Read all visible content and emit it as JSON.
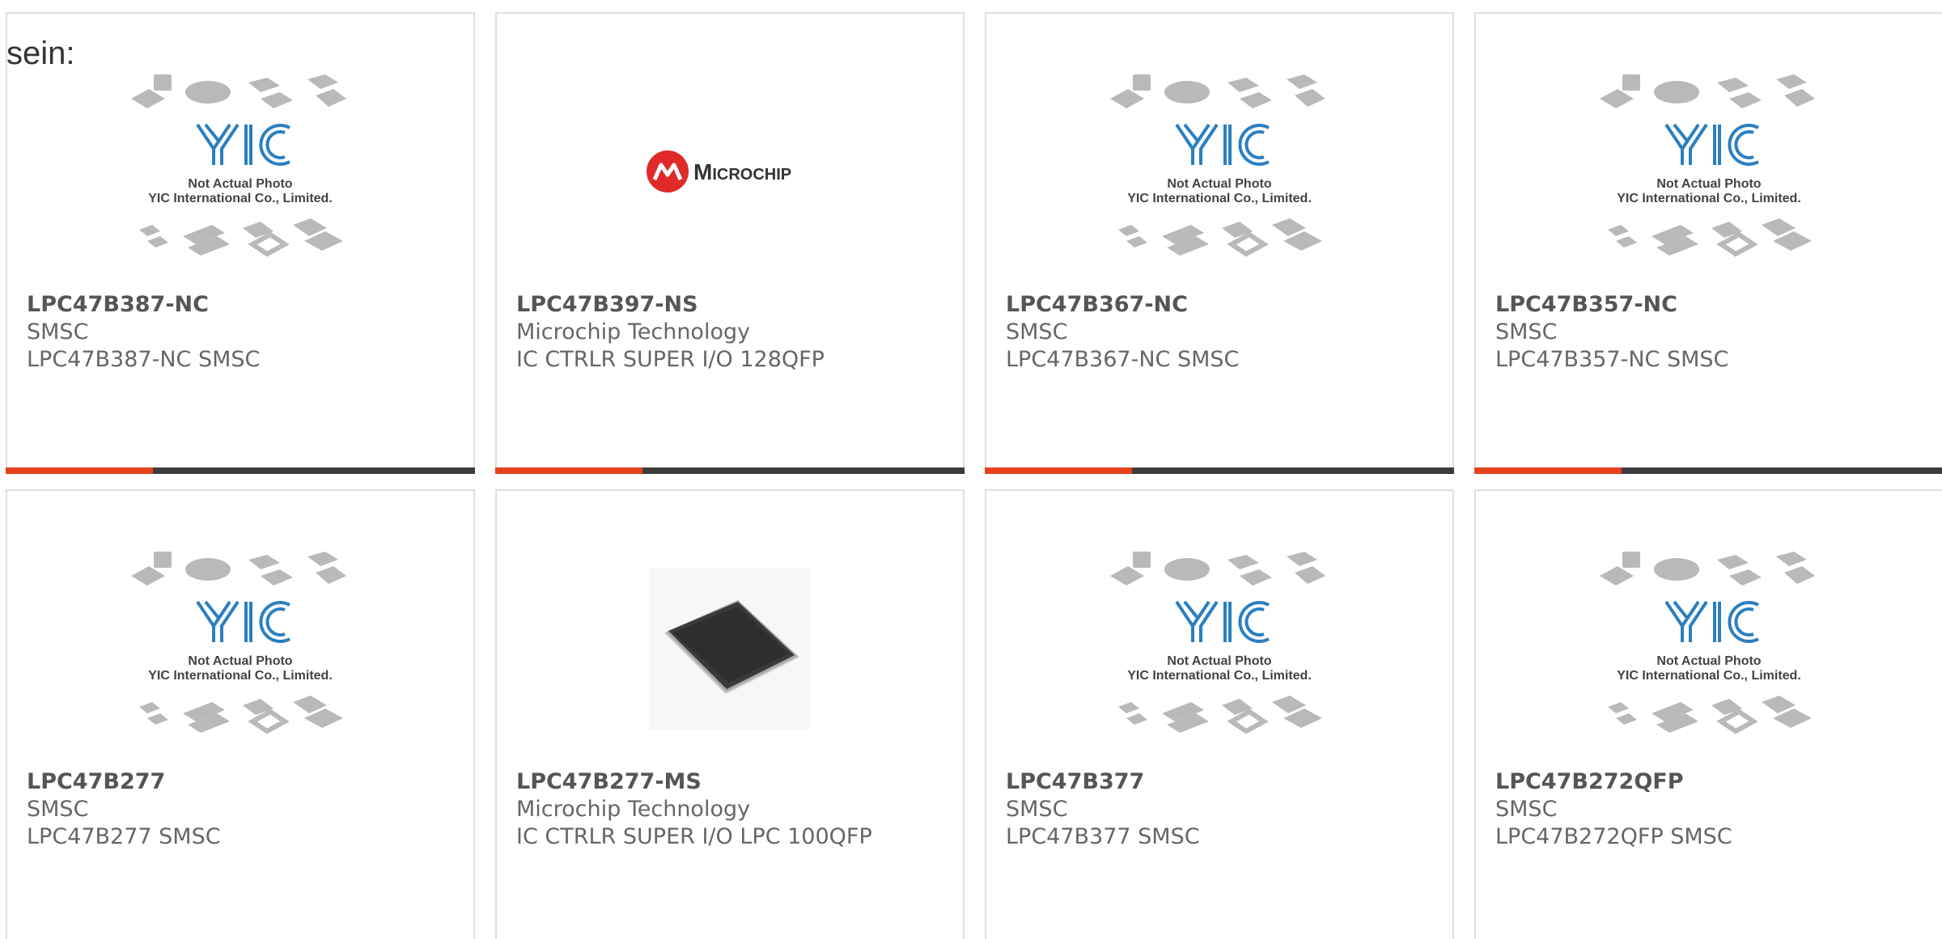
{
  "heading": "sein:",
  "placeholder": {
    "line1": "Not Actual Photo",
    "line2": "YIC International Co., Limited."
  },
  "brand_logo_text": "Microchip",
  "colors": {
    "accent": "#e6401c",
    "bar": "#3d3d3d",
    "logo_red": "#e02a2a",
    "yic_blue": "#2a7fc1"
  },
  "cards": [
    {
      "pn": "LPC47B387-NC",
      "mfr": "SMSC",
      "desc": "LPC47B387-NC SMSC",
      "image": "yic-placeholder"
    },
    {
      "pn": "LPC47B397-NS",
      "mfr": "Microchip Technology",
      "desc": "IC CTRLR SUPER I/O 128QFP",
      "image": "microchip-logo"
    },
    {
      "pn": "LPC47B367-NC",
      "mfr": "SMSC",
      "desc": "LPC47B367-NC SMSC",
      "image": "yic-placeholder"
    },
    {
      "pn": "LPC47B357-NC",
      "mfr": "SMSC",
      "desc": "LPC47B357-NC SMSC",
      "image": "yic-placeholder"
    },
    {
      "pn": "LPC47B277",
      "mfr": "SMSC",
      "desc": "LPC47B277 SMSC",
      "image": "yic-placeholder"
    },
    {
      "pn": "LPC47B277-MS",
      "mfr": "Microchip Technology",
      "desc": "IC CTRLR SUPER I/O LPC 100QFP",
      "image": "qfp-chip-photo"
    },
    {
      "pn": "LPC47B377",
      "mfr": "SMSC",
      "desc": "LPC47B377 SMSC",
      "image": "yic-placeholder"
    },
    {
      "pn": "LPC47B272QFP",
      "mfr": "SMSC",
      "desc": "LPC47B272QFP SMSC",
      "image": "yic-placeholder"
    }
  ]
}
